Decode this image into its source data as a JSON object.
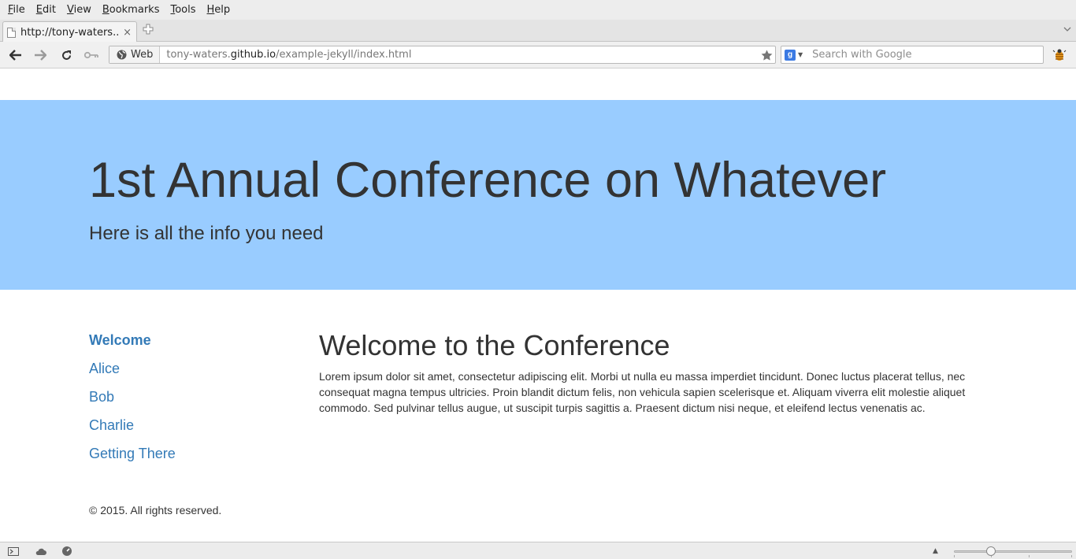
{
  "browser": {
    "menu": [
      "File",
      "Edit",
      "View",
      "Bookmarks",
      "Tools",
      "Help"
    ],
    "tab": {
      "title": "http://tony-waters....",
      "close": "×"
    },
    "identity_label": "Web",
    "url": {
      "prefix": "tony-waters.",
      "domain": "github.io",
      "path": "/example-jekyll/index.html"
    },
    "search": {
      "placeholder": "Search with Google",
      "engine_letter": "g"
    },
    "zoom": {
      "level": 0.3
    }
  },
  "page": {
    "jumbotron": {
      "title": "1st Annual Conference on Whatever",
      "subtitle": "Here is all the info you need",
      "background": "#99ccff"
    },
    "sidebar": {
      "items": [
        {
          "label": "Welcome",
          "active": true
        },
        {
          "label": "Alice"
        },
        {
          "label": "Bob"
        },
        {
          "label": "Charlie"
        },
        {
          "label": "Getting There"
        }
      ]
    },
    "main": {
      "title": "Welcome to the Conference",
      "body": "Lorem ipsum dolor sit amet, consectetur adipiscing elit. Morbi ut nulla eu massa imperdiet tincidunt. Donec luctus placerat tellus, nec consequat magna tempus ultricies. Proin blandit dictum felis, non vehicula sapien scelerisque et. Aliquam viverra elit molestie aliquet commodo. Sed pulvinar tellus augue, ut suscipit turpis sagittis a. Praesent dictum nisi neque, et eleifend lectus venenatis ac."
    },
    "footer": {
      "text": "© 2015. All rights reserved."
    },
    "link_color": "#337ab7"
  }
}
